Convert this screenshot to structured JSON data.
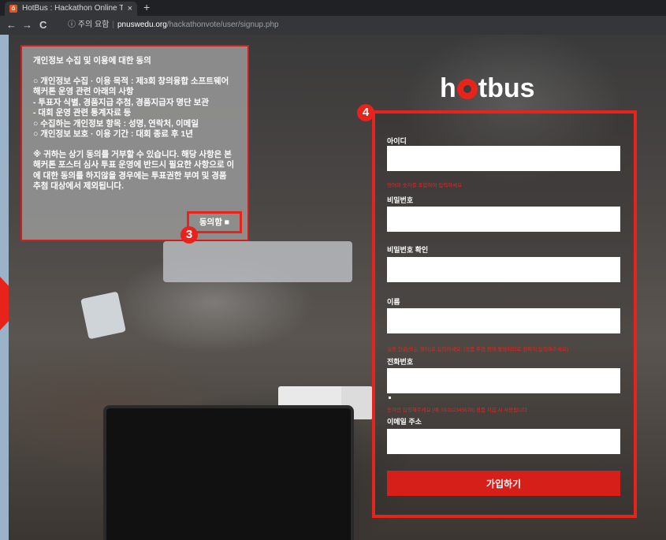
{
  "browser": {
    "tab_title": "HotBus : Hackathon Online Te:",
    "tab_close": "×",
    "new_tab": "+",
    "back": "←",
    "forward": "→",
    "reload": "C",
    "security": "ⓘ 주의 요함",
    "url_host": "pnuswedu.org",
    "url_path": "/hackathonvote/user/signup.php"
  },
  "consent": {
    "title": "개인정보 수집 및 이용에 대한 동의",
    "lines": [
      "○ 개인정보 수집 · 이용 목적 : 제3회 창의융합 소프트웨어 해커톤 운영 관련 아래의 사항",
      "- 투표자 식별, 경품지급 추첨, 경품지급자 명단 보관",
      "- 대회 운영 관련 통계자료 등",
      "○ 수집하는 개인정보 항목 : 성명, 연락처, 이메일",
      "○ 개인정보 보호 · 이용 기간 : 대회 종료 후 1년"
    ],
    "notice": "※ 귀하는 상기 동의를 거부할 수 있습니다. 해당 사항은 본 해커톤 포스터 심사 투표 운영에 반드시 필요한 사항으로 이에 대한 동의를 하지않을 경우에는 투표권한 부여 및 경품 추첨 대상에서 제외됩니다.",
    "agree_label": "동의함 ■"
  },
  "badges": {
    "consent": "3",
    "form": "4"
  },
  "logo": {
    "left": "h",
    "right": "tbus"
  },
  "form": {
    "id_label": "아이디",
    "id_error": "영어와 숫자를 조합하여 입력하세요",
    "pw_label": "비밀번호",
    "pw_confirm_label": "비밀번호 확인",
    "name_label": "이름",
    "name_error": "실명 한글(또는 영어)로 입력하세요. (경품 추첨 등에 활용되므로 정확히 입력해주세요)",
    "phone_label": "전화번호",
    "phone_error": "숫자만 입력해주세요 (예: 01012345678) 경품 지급 시 사용됩니다",
    "email_label": "이메일 주소",
    "submit_label": "가입하기"
  },
  "colors": {
    "accent": "#e8231b",
    "button": "#d71f1a"
  }
}
